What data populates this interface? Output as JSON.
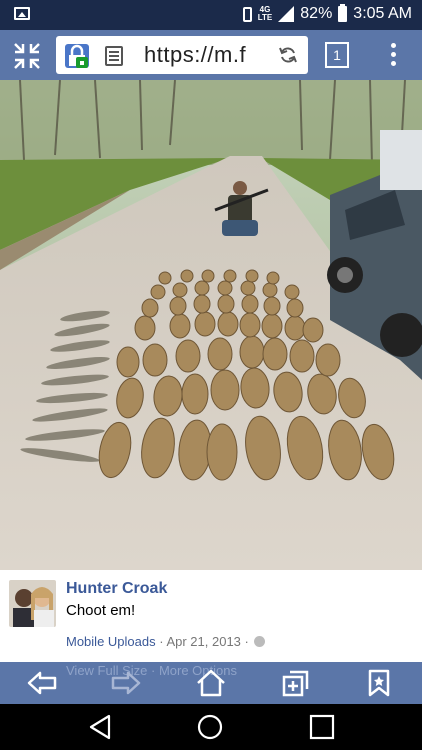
{
  "status_bar": {
    "network_badge_top": "4G",
    "network_badge_bottom": "LTE",
    "battery": "82%",
    "time": "3:05 AM"
  },
  "browser": {
    "url": "https://m.f",
    "tab_count": "1"
  },
  "post": {
    "author": "Hunter Croak",
    "text": "Choot em!",
    "album": "Mobile Uploads",
    "separator": " · ",
    "date": "Apr 21, 2013",
    "separator2": " · ",
    "links_behind": "View Full Size · More Options"
  },
  "colors": {
    "status_bar": "#1b2a4a",
    "toolbar": "#5b76a8",
    "link": "#3b5998"
  },
  "icons": [
    "gallery-icon",
    "vibrate-icon",
    "signal-icon",
    "battery-icon",
    "exit-fullscreen-icon",
    "lock-icon",
    "page-icon",
    "reload-icon",
    "tabs-icon",
    "menu-icon",
    "back-icon",
    "forward-icon",
    "home-icon",
    "add-tab-icon",
    "bookmark-icon",
    "nav-back-icon",
    "nav-home-icon",
    "nav-recents-icon",
    "globe-icon"
  ]
}
